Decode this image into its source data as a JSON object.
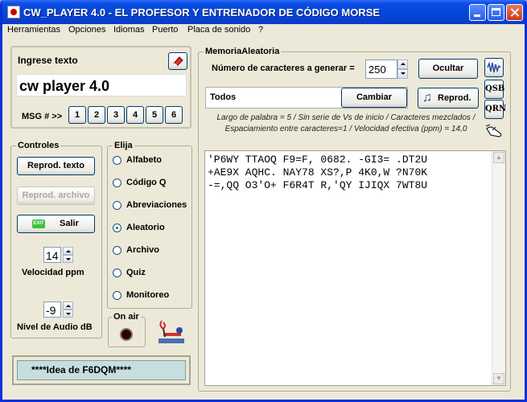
{
  "window": {
    "title": "CW_PLAYER 4.0 - EL PROFESOR Y ENTRENADOR DE CÓDIGO MORSE"
  },
  "menu": [
    "Herramientas",
    "Opciones",
    "Idiomas",
    "Puerto",
    "Placa de sonido",
    "?"
  ],
  "input_panel": {
    "title": "Ingrese texto",
    "value": "cw player 4.0",
    "msg_label": "MSG # >>",
    "msg_buttons": [
      "1",
      "2",
      "3",
      "4",
      "5",
      "6"
    ]
  },
  "controls": {
    "title": "Controles",
    "play_text": "Reprod. texto",
    "play_file": "Reprod. archivo",
    "exit": "Salir",
    "exit_badge": "EXIT",
    "speed_value": "14",
    "speed_label": "Velocidad ppm",
    "audio_value": "-9",
    "audio_label": "Nivel de Audio dB"
  },
  "mode": {
    "title": "Elija",
    "options": [
      "Alfabeto",
      "Código Q",
      "Abreviaciones",
      "Aleatorio",
      "Archivo",
      "Quiz",
      "Monitoreo"
    ],
    "selected": 3
  },
  "on_air": {
    "label": "On air"
  },
  "credit": "****Idea de F6DQM****",
  "random_memory": {
    "title": "MemoriaAleatoria",
    "count_label": "Número de caracteres a generar =",
    "count_value": "250",
    "hide_button": "Ocultar",
    "charset_value": "Todos",
    "change_button": "Cambiar",
    "play_button": "Reprod.",
    "info": "Largo de palabra = 5 / Sin serie de Vs de inicio / Caracteres mezclados / Espaciamiento entre caracteres=1 / Velocidad efectiva (ppm) = 14,0",
    "lines": [
      "'P6WY TTAOQ F9=F, 0682. -GI3= .DT2U",
      "+AE9X AQHC. NAY78 XS?,P 4K0,W ?N70K",
      "-=,QQ O3'O+ F6R4T R,'QY IJIQX 7WT8U"
    ],
    "side_buttons": [
      "QSB",
      "QRN"
    ]
  },
  "colors": {
    "titlebar": "#0645d8",
    "credit_bg": "#c7dede",
    "accent": "#0831d9"
  }
}
